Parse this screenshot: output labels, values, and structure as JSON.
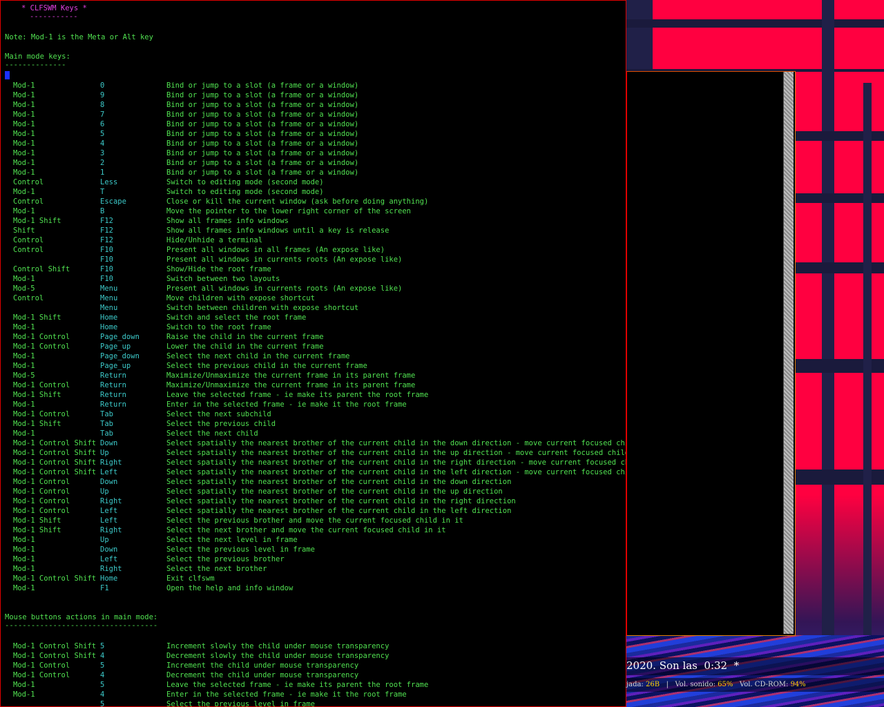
{
  "help": {
    "title": "* CLFSWM Keys *",
    "title_underline": "-----------",
    "note": "Note: Mod-1 is the Meta or Alt key",
    "main_heading": "Main mode keys:",
    "main_underline": "--------------",
    "keys": [
      {
        "mods": "Mod-1",
        "key": "0",
        "desc": "Bind or jump to a slot (a frame or a window)"
      },
      {
        "mods": "Mod-1",
        "key": "9",
        "desc": "Bind or jump to a slot (a frame or a window)"
      },
      {
        "mods": "Mod-1",
        "key": "8",
        "desc": "Bind or jump to a slot (a frame or a window)"
      },
      {
        "mods": "Mod-1",
        "key": "7",
        "desc": "Bind or jump to a slot (a frame or a window)"
      },
      {
        "mods": "Mod-1",
        "key": "6",
        "desc": "Bind or jump to a slot (a frame or a window)"
      },
      {
        "mods": "Mod-1",
        "key": "5",
        "desc": "Bind or jump to a slot (a frame or a window)"
      },
      {
        "mods": "Mod-1",
        "key": "4",
        "desc": "Bind or jump to a slot (a frame or a window)"
      },
      {
        "mods": "Mod-1",
        "key": "3",
        "desc": "Bind or jump to a slot (a frame or a window)"
      },
      {
        "mods": "Mod-1",
        "key": "2",
        "desc": "Bind or jump to a slot (a frame or a window)"
      },
      {
        "mods": "Mod-1",
        "key": "1",
        "desc": "Bind or jump to a slot (a frame or a window)"
      },
      {
        "mods": "Control",
        "key": "Less",
        "desc": "Switch to editing mode (second mode)"
      },
      {
        "mods": "Mod-1",
        "key": "T",
        "desc": "Switch to editing mode (second mode)"
      },
      {
        "mods": "Control",
        "key": "Escape",
        "desc": "Close or kill the current window (ask before doing anything)"
      },
      {
        "mods": "Mod-1",
        "key": "B",
        "desc": "Move the pointer to the lower right corner of the screen"
      },
      {
        "mods": "Mod-1 Shift",
        "key": "F12",
        "desc": "Show all frames info windows"
      },
      {
        "mods": "Shift",
        "key": "F12",
        "desc": "Show all frames info windows until a key is release"
      },
      {
        "mods": "Control",
        "key": "F12",
        "desc": "Hide/Unhide a terminal"
      },
      {
        "mods": "Control",
        "key": "F10",
        "desc": "Present all windows in all frames (An expose like)"
      },
      {
        "mods": "",
        "key": "F10",
        "desc": "Present all windows in currents roots (An expose like)"
      },
      {
        "mods": "Control Shift",
        "key": "F10",
        "desc": "Show/Hide the root frame"
      },
      {
        "mods": "Mod-1",
        "key": "F10",
        "desc": "Switch between two layouts"
      },
      {
        "mods": "Mod-5",
        "key": "Menu",
        "desc": "Present all windows in currents roots (An expose like)"
      },
      {
        "mods": "Control",
        "key": "Menu",
        "desc": "Move children with expose shortcut"
      },
      {
        "mods": "",
        "key": "Menu",
        "desc": "Switch between children with expose shortcut"
      },
      {
        "mods": "Mod-1 Shift",
        "key": "Home",
        "desc": "Switch and select the root frame"
      },
      {
        "mods": "Mod-1",
        "key": "Home",
        "desc": "Switch to the root frame"
      },
      {
        "mods": "Mod-1 Control",
        "key": "Page_down",
        "desc": "Raise the child in the current frame"
      },
      {
        "mods": "Mod-1 Control",
        "key": "Page_up",
        "desc": "Lower the child in the current frame"
      },
      {
        "mods": "Mod-1",
        "key": "Page_down",
        "desc": "Select the next child in the current frame"
      },
      {
        "mods": "Mod-1",
        "key": "Page_up",
        "desc": "Select the previous child in the current frame"
      },
      {
        "mods": "Mod-5",
        "key": "Return",
        "desc": "Maximize/Unmaximize the current frame in its parent frame"
      },
      {
        "mods": "Mod-1 Control",
        "key": "Return",
        "desc": "Maximize/Unmaximize the current frame in its parent frame"
      },
      {
        "mods": "Mod-1 Shift",
        "key": "Return",
        "desc": "Leave the selected frame - ie make its parent the root frame"
      },
      {
        "mods": "Mod-1",
        "key": "Return",
        "desc": "Enter in the selected frame - ie make it the root frame"
      },
      {
        "mods": "Mod-1 Control",
        "key": "Tab",
        "desc": "Select the next subchild"
      },
      {
        "mods": "Mod-1 Shift",
        "key": "Tab",
        "desc": "Select the previous child"
      },
      {
        "mods": "Mod-1",
        "key": "Tab",
        "desc": "Select the next child"
      },
      {
        "mods": "Mod-1 Control Shift",
        "key": "Down",
        "desc": "Select spatially the nearest brother of the current child in the down direction - move current focused child"
      },
      {
        "mods": "Mod-1 Control Shift",
        "key": "Up",
        "desc": "Select spatially the nearest brother of the current child in the up direction - move current focused child"
      },
      {
        "mods": "Mod-1 Control Shift",
        "key": "Right",
        "desc": "Select spatially the nearest brother of the current child in the right direction - move current focused child"
      },
      {
        "mods": "Mod-1 Control Shift",
        "key": "Left",
        "desc": "Select spatially the nearest brother of the current child in the left direction - move current focused child"
      },
      {
        "mods": "Mod-1 Control",
        "key": "Down",
        "desc": "Select spatially the nearest brother of the current child in the down direction"
      },
      {
        "mods": "Mod-1 Control",
        "key": "Up",
        "desc": "Select spatially the nearest brother of the current child in the up direction"
      },
      {
        "mods": "Mod-1 Control",
        "key": "Right",
        "desc": "Select spatially the nearest brother of the current child in the right direction"
      },
      {
        "mods": "Mod-1 Control",
        "key": "Left",
        "desc": "Select spatially the nearest brother of the current child in the left direction"
      },
      {
        "mods": "Mod-1 Shift",
        "key": "Left",
        "desc": "Select the previous brother and move the current focused child in it"
      },
      {
        "mods": "Mod-1 Shift",
        "key": "Right",
        "desc": "Select the next brother and move the current focused child in it"
      },
      {
        "mods": "Mod-1",
        "key": "Up",
        "desc": "Select the next level in frame"
      },
      {
        "mods": "Mod-1",
        "key": "Down",
        "desc": "Select the previous level in frame"
      },
      {
        "mods": "Mod-1",
        "key": "Left",
        "desc": "Select the previous brother"
      },
      {
        "mods": "Mod-1",
        "key": "Right",
        "desc": "Select the next brother"
      },
      {
        "mods": "Mod-1 Control Shift",
        "key": "Home",
        "desc": "Exit clfswm"
      },
      {
        "mods": "Mod-1",
        "key": "F1",
        "desc": "Open the help and info window"
      }
    ],
    "mouse_heading": "Mouse buttons actions in main mode:",
    "mouse_underline": "-----------------------------------",
    "mouse": [
      {
        "mods": "Mod-1 Control Shift",
        "key": "5",
        "desc": "Increment slowly the child under mouse transparency"
      },
      {
        "mods": "Mod-1 Control Shift",
        "key": "4",
        "desc": "Decrement slowly the child under mouse transparency"
      },
      {
        "mods": "Mod-1 Control",
        "key": "5",
        "desc": "Increment the child under mouse transparency"
      },
      {
        "mods": "Mod-1 Control",
        "key": "4",
        "desc": "Decrement the child under mouse transparency"
      },
      {
        "mods": "Mod-1",
        "key": "5",
        "desc": "Leave the selected frame - ie make its parent the root frame"
      },
      {
        "mods": "Mod-1",
        "key": "4",
        "desc": "Enter in the selected frame - ie make it the root frame"
      },
      {
        "mods": "",
        "key": "5",
        "desc": "Select the previous level in frame"
      }
    ]
  },
  "statusbar": {
    "clock": "2020. Son las  0:32  *",
    "info_1": "jada: ",
    "info_1_val": "26B",
    "info_sep": "   |   Vol. sonido: ",
    "info_2_val": "65%",
    "info_3": "   Vol. CD-ROM: ",
    "info_3_val": "94%"
  },
  "colors": {
    "window_border": "#e00000",
    "title": "#e040e0",
    "text": "#50e050",
    "key": "#3cc8c8",
    "cursor": "#1a30ff",
    "status_value": "#ffd000"
  }
}
